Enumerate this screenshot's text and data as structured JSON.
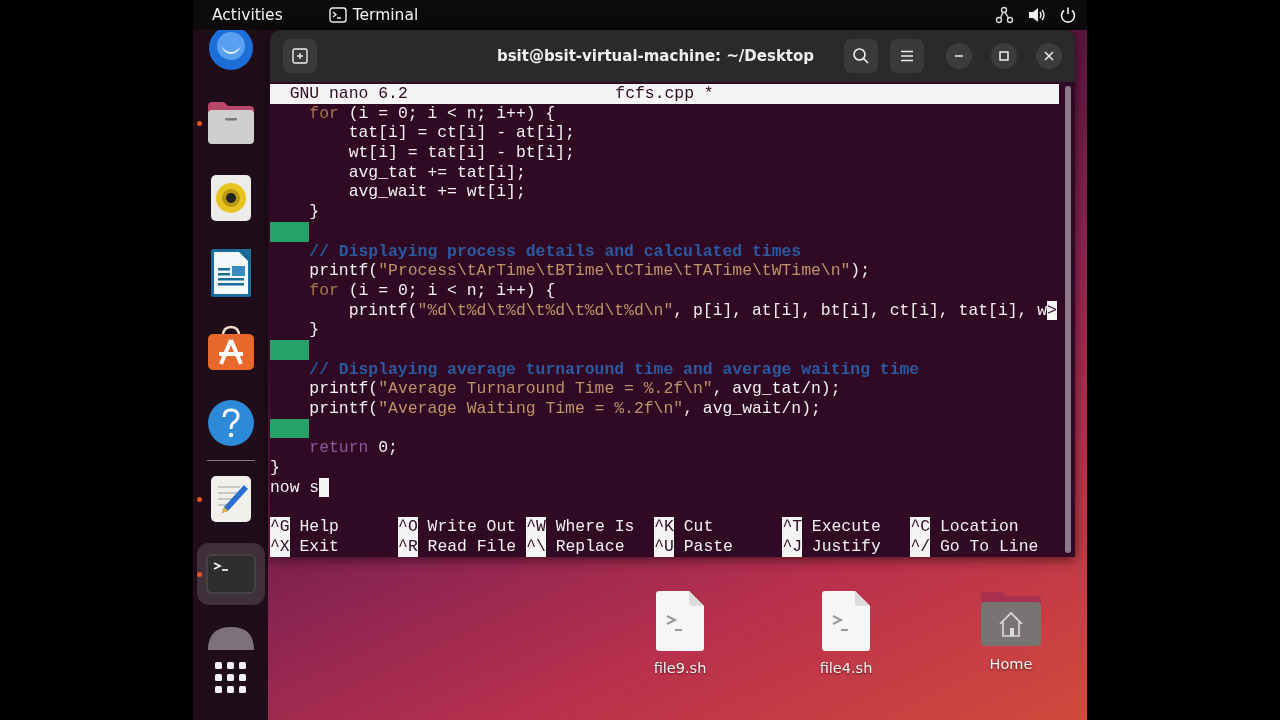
{
  "top_bar": {
    "activities": "Activities",
    "app_name": "Terminal"
  },
  "dock": {
    "items": [
      {
        "kind": "browser",
        "running": false,
        "selected": false
      },
      {
        "kind": "files",
        "running": true,
        "selected": false
      },
      {
        "kind": "music",
        "running": false,
        "selected": false
      },
      {
        "kind": "document",
        "running": false,
        "selected": false
      },
      {
        "kind": "store",
        "running": false,
        "selected": false
      },
      {
        "kind": "help",
        "running": false,
        "selected": false
      },
      {
        "kind": "separator"
      },
      {
        "kind": "editor",
        "running": true,
        "selected": false
      },
      {
        "kind": "terminal",
        "running": true,
        "selected": true
      },
      {
        "kind": "partial",
        "running": false,
        "selected": false
      },
      {
        "kind": "apps"
      }
    ]
  },
  "window": {
    "title": "bsit@bsit-virtual-machine: ~/Desktop"
  },
  "nano": {
    "version": "GNU nano 6.2",
    "filename": "fcfs.cpp *",
    "lines": [
      {
        "kind": "code",
        "segments": [
          {
            "kind": "keyword",
            "text": "    for"
          },
          {
            "kind": "plain",
            "text": " (i = 0; i < n; i++) {"
          }
        ]
      },
      {
        "kind": "code",
        "segments": [
          {
            "kind": "plain",
            "text": "        tat[i] = ct[i] - at[i];"
          }
        ]
      },
      {
        "kind": "code",
        "segments": [
          {
            "kind": "plain",
            "text": "        wt[i] = tat[i] - bt[i];"
          }
        ]
      },
      {
        "kind": "code",
        "segments": [
          {
            "kind": "plain",
            "text": "        avg_tat += tat[i];"
          }
        ]
      },
      {
        "kind": "code",
        "segments": [
          {
            "kind": "plain",
            "text": "        avg_wait += wt[i];"
          }
        ]
      },
      {
        "kind": "code",
        "segments": [
          {
            "kind": "plain",
            "text": "    }"
          }
        ]
      },
      {
        "kind": "whitespace"
      },
      {
        "kind": "code",
        "segments": [
          {
            "kind": "comment",
            "text": "    // Displaying process details and calculated times"
          }
        ]
      },
      {
        "kind": "code",
        "segments": [
          {
            "kind": "plain",
            "text": "    printf("
          },
          {
            "kind": "string",
            "text": "\"Process\\tArTime\\tBTime\\tCTime\\tTATime\\tWTime\\n\""
          },
          {
            "kind": "plain",
            "text": ");"
          }
        ]
      },
      {
        "kind": "code",
        "segments": [
          {
            "kind": "keyword",
            "text": "    for"
          },
          {
            "kind": "plain",
            "text": " (i = 0; i < n; i++) {"
          }
        ]
      },
      {
        "kind": "code",
        "segments": [
          {
            "kind": "plain",
            "text": "        printf("
          },
          {
            "kind": "string",
            "text": "\"%d\\t%d\\t%d\\t%d\\t%d\\t%d\\n\""
          },
          {
            "kind": "plain",
            "text": ", p[i], at[i], bt[i], ct[i], tat[i], w"
          },
          {
            "kind": "overflow",
            "text": ">"
          }
        ]
      },
      {
        "kind": "code",
        "segments": [
          {
            "kind": "plain",
            "text": "    }"
          }
        ]
      },
      {
        "kind": "whitespace"
      },
      {
        "kind": "code",
        "segments": [
          {
            "kind": "comment",
            "text": "    // Displaying average turnaround time and average waiting time"
          }
        ]
      },
      {
        "kind": "code",
        "segments": [
          {
            "kind": "plain",
            "text": "    printf("
          },
          {
            "kind": "string",
            "text": "\"Average Turnaround Time = %.2f\\n\""
          },
          {
            "kind": "plain",
            "text": ", avg_tat/n);"
          }
        ]
      },
      {
        "kind": "code",
        "segments": [
          {
            "kind": "plain",
            "text": "    printf("
          },
          {
            "kind": "string",
            "text": "\"Average Waiting Time = %.2f\\n\""
          },
          {
            "kind": "plain",
            "text": ", avg_wait/n);"
          }
        ]
      },
      {
        "kind": "whitespace"
      },
      {
        "kind": "code",
        "segments": [
          {
            "kind": "control",
            "text": "    return"
          },
          {
            "kind": "plain",
            "text": " 0;"
          }
        ]
      },
      {
        "kind": "code",
        "segments": [
          {
            "kind": "plain",
            "text": "}"
          }
        ]
      },
      {
        "kind": "code",
        "cursor": true,
        "segments": [
          {
            "kind": "plain",
            "text": "now s"
          }
        ]
      }
    ],
    "shortcuts": [
      {
        "key": "^G",
        "label": "Help"
      },
      {
        "key": "^O",
        "label": "Write Out"
      },
      {
        "key": "^W",
        "label": "Where Is"
      },
      {
        "key": "^K",
        "label": "Cut"
      },
      {
        "key": "^T",
        "label": "Execute"
      },
      {
        "key": "^C",
        "label": "Location"
      },
      {
        "key": "^X",
        "label": "Exit"
      },
      {
        "key": "^R",
        "label": "Read File"
      },
      {
        "key": "^\\",
        "label": "Replace"
      },
      {
        "key": "^U",
        "label": "Paste"
      },
      {
        "key": "^J",
        "label": "Justify"
      },
      {
        "key": "^/",
        "label": "Go To Line"
      }
    ]
  },
  "desktop_icons": [
    {
      "kind": "script",
      "label": "file9.sh"
    },
    {
      "kind": "script",
      "label": "file4.sh"
    },
    {
      "kind": "home",
      "label": "Home"
    }
  ]
}
